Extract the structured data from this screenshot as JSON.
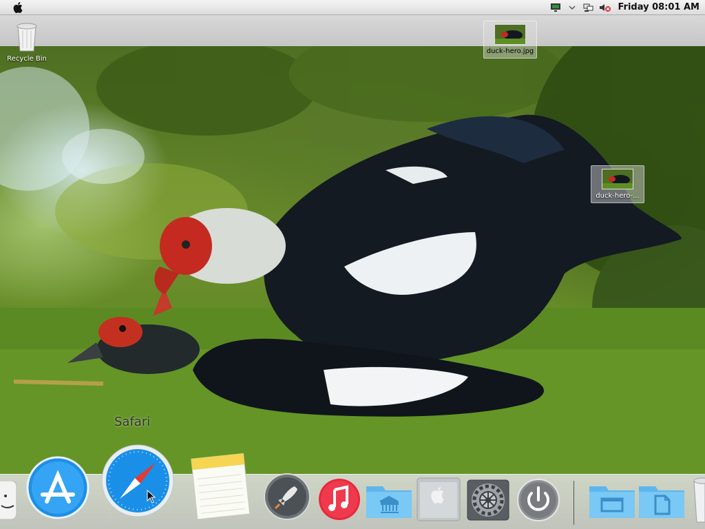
{
  "menubar": {
    "clock": "Friday 08:01 AM",
    "tray_icons": [
      "monitor-icon",
      "chevron-down-icon",
      "network-icon",
      "volume-muted-icon"
    ]
  },
  "desktop": {
    "icons": [
      {
        "label": "Recycle Bin",
        "icon": "trash-icon"
      },
      {
        "label": "duck-hero.jpg",
        "icon": "image-thumbnail"
      },
      {
        "label": "duck-hero-...",
        "icon": "image-thumbnail"
      }
    ]
  },
  "dock": {
    "tooltip": "Safari",
    "items": [
      "finder-icon",
      "app-store-icon",
      "safari-icon",
      "notes-icon",
      "launchpad-icon",
      "music-icon",
      "library-folder-icon",
      "mac-pro-icon",
      "system-preferences-icon",
      "power-icon",
      "desktop-folder-icon",
      "documents-folder-icon",
      "trash-icon"
    ]
  },
  "colors": {
    "menubar": "#e6e6e6",
    "folder_blue": "#6cc0f0",
    "music_red": "#e8283c",
    "safari_blue": "#1a8fe8"
  }
}
